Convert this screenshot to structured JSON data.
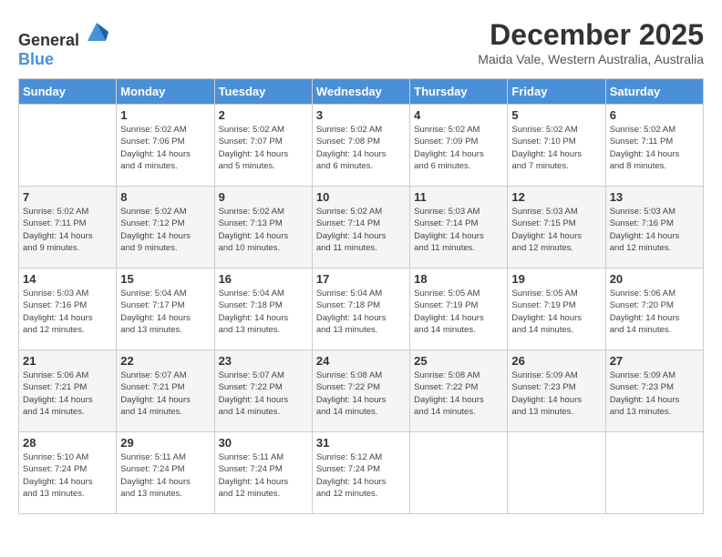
{
  "logo": {
    "text_general": "General",
    "text_blue": "Blue"
  },
  "header": {
    "month_year": "December 2025",
    "location": "Maida Vale, Western Australia, Australia"
  },
  "days_of_week": [
    "Sunday",
    "Monday",
    "Tuesday",
    "Wednesday",
    "Thursday",
    "Friday",
    "Saturday"
  ],
  "weeks": [
    [
      {
        "day": "",
        "info": ""
      },
      {
        "day": "1",
        "info": "Sunrise: 5:02 AM\nSunset: 7:06 PM\nDaylight: 14 hours\nand 4 minutes."
      },
      {
        "day": "2",
        "info": "Sunrise: 5:02 AM\nSunset: 7:07 PM\nDaylight: 14 hours\nand 5 minutes."
      },
      {
        "day": "3",
        "info": "Sunrise: 5:02 AM\nSunset: 7:08 PM\nDaylight: 14 hours\nand 6 minutes."
      },
      {
        "day": "4",
        "info": "Sunrise: 5:02 AM\nSunset: 7:09 PM\nDaylight: 14 hours\nand 6 minutes."
      },
      {
        "day": "5",
        "info": "Sunrise: 5:02 AM\nSunset: 7:10 PM\nDaylight: 14 hours\nand 7 minutes."
      },
      {
        "day": "6",
        "info": "Sunrise: 5:02 AM\nSunset: 7:11 PM\nDaylight: 14 hours\nand 8 minutes."
      }
    ],
    [
      {
        "day": "7",
        "info": "Sunrise: 5:02 AM\nSunset: 7:11 PM\nDaylight: 14 hours\nand 9 minutes."
      },
      {
        "day": "8",
        "info": "Sunrise: 5:02 AM\nSunset: 7:12 PM\nDaylight: 14 hours\nand 9 minutes."
      },
      {
        "day": "9",
        "info": "Sunrise: 5:02 AM\nSunset: 7:13 PM\nDaylight: 14 hours\nand 10 minutes."
      },
      {
        "day": "10",
        "info": "Sunrise: 5:02 AM\nSunset: 7:14 PM\nDaylight: 14 hours\nand 11 minutes."
      },
      {
        "day": "11",
        "info": "Sunrise: 5:03 AM\nSunset: 7:14 PM\nDaylight: 14 hours\nand 11 minutes."
      },
      {
        "day": "12",
        "info": "Sunrise: 5:03 AM\nSunset: 7:15 PM\nDaylight: 14 hours\nand 12 minutes."
      },
      {
        "day": "13",
        "info": "Sunrise: 5:03 AM\nSunset: 7:16 PM\nDaylight: 14 hours\nand 12 minutes."
      }
    ],
    [
      {
        "day": "14",
        "info": "Sunrise: 5:03 AM\nSunset: 7:16 PM\nDaylight: 14 hours\nand 12 minutes."
      },
      {
        "day": "15",
        "info": "Sunrise: 5:04 AM\nSunset: 7:17 PM\nDaylight: 14 hours\nand 13 minutes."
      },
      {
        "day": "16",
        "info": "Sunrise: 5:04 AM\nSunset: 7:18 PM\nDaylight: 14 hours\nand 13 minutes."
      },
      {
        "day": "17",
        "info": "Sunrise: 5:04 AM\nSunset: 7:18 PM\nDaylight: 14 hours\nand 13 minutes."
      },
      {
        "day": "18",
        "info": "Sunrise: 5:05 AM\nSunset: 7:19 PM\nDaylight: 14 hours\nand 14 minutes."
      },
      {
        "day": "19",
        "info": "Sunrise: 5:05 AM\nSunset: 7:19 PM\nDaylight: 14 hours\nand 14 minutes."
      },
      {
        "day": "20",
        "info": "Sunrise: 5:06 AM\nSunset: 7:20 PM\nDaylight: 14 hours\nand 14 minutes."
      }
    ],
    [
      {
        "day": "21",
        "info": "Sunrise: 5:06 AM\nSunset: 7:21 PM\nDaylight: 14 hours\nand 14 minutes."
      },
      {
        "day": "22",
        "info": "Sunrise: 5:07 AM\nSunset: 7:21 PM\nDaylight: 14 hours\nand 14 minutes."
      },
      {
        "day": "23",
        "info": "Sunrise: 5:07 AM\nSunset: 7:22 PM\nDaylight: 14 hours\nand 14 minutes."
      },
      {
        "day": "24",
        "info": "Sunrise: 5:08 AM\nSunset: 7:22 PM\nDaylight: 14 hours\nand 14 minutes."
      },
      {
        "day": "25",
        "info": "Sunrise: 5:08 AM\nSunset: 7:22 PM\nDaylight: 14 hours\nand 14 minutes."
      },
      {
        "day": "26",
        "info": "Sunrise: 5:09 AM\nSunset: 7:23 PM\nDaylight: 14 hours\nand 13 minutes."
      },
      {
        "day": "27",
        "info": "Sunrise: 5:09 AM\nSunset: 7:23 PM\nDaylight: 14 hours\nand 13 minutes."
      }
    ],
    [
      {
        "day": "28",
        "info": "Sunrise: 5:10 AM\nSunset: 7:24 PM\nDaylight: 14 hours\nand 13 minutes."
      },
      {
        "day": "29",
        "info": "Sunrise: 5:11 AM\nSunset: 7:24 PM\nDaylight: 14 hours\nand 13 minutes."
      },
      {
        "day": "30",
        "info": "Sunrise: 5:11 AM\nSunset: 7:24 PM\nDaylight: 14 hours\nand 12 minutes."
      },
      {
        "day": "31",
        "info": "Sunrise: 5:12 AM\nSunset: 7:24 PM\nDaylight: 14 hours\nand 12 minutes."
      },
      {
        "day": "",
        "info": ""
      },
      {
        "day": "",
        "info": ""
      },
      {
        "day": "",
        "info": ""
      }
    ]
  ]
}
